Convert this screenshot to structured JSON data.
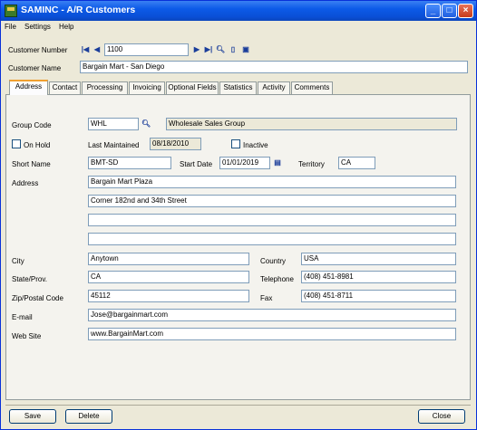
{
  "window": {
    "title": "SAMINC - A/R Customers",
    "minimize": "_",
    "maximize": "□",
    "close": "×"
  },
  "menu": {
    "file": "File",
    "settings": "Settings",
    "help": "Help"
  },
  "header": {
    "customer_number_label": "Customer Number",
    "customer_number": "1100",
    "customer_name_label": "Customer Name",
    "customer_name": "Bargain Mart - San Diego"
  },
  "tabs": [
    "Address",
    "Contact",
    "Processing",
    "Invoicing",
    "Optional Fields",
    "Statistics",
    "Activity",
    "Comments"
  ],
  "address": {
    "group_code_label": "Group Code",
    "group_code": "WHL",
    "group_description": "Wholesale Sales Group",
    "on_hold_label": "On Hold",
    "last_maintained_label": "Last Maintained",
    "last_maintained": "08/18/2010",
    "inactive_label": "Inactive",
    "short_name_label": "Short Name",
    "short_name": "BMT-SD",
    "start_date_label": "Start Date",
    "start_date": "01/01/2019",
    "territory_label": "Territory",
    "territory": "CA",
    "address_label": "Address",
    "address_lines": [
      "Bargain Mart Plaza",
      "Corner 182nd and 34th Street",
      "",
      ""
    ],
    "city_label": "City",
    "city": "Anytown",
    "country_label": "Country",
    "country": "USA",
    "state_label": "State/Prov.",
    "state": "CA",
    "telephone_label": "Telephone",
    "telephone": "(408) 451-8981",
    "zip_label": "Zip/Postal Code",
    "zip": "45112",
    "fax_label": "Fax",
    "fax": "(408) 451-8711",
    "email_label": "E-mail",
    "email": "Jose@bargainmart.com",
    "website_label": "Web Site",
    "website": "www.BargainMart.com"
  },
  "buttons": {
    "save": "Save",
    "delete": "Delete",
    "close": "Close"
  }
}
